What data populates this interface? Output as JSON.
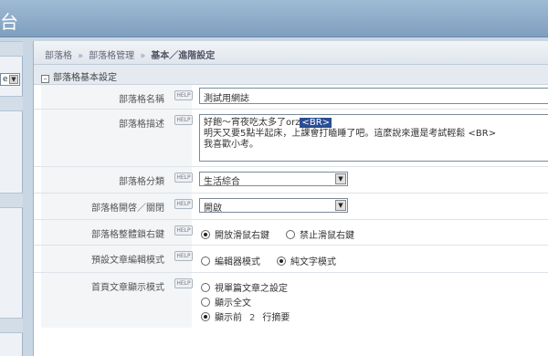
{
  "header": {
    "title": "台"
  },
  "sidebar": {
    "combo_value": "e"
  },
  "breadcrumb": {
    "items": [
      "部落格",
      "部落格管理"
    ],
    "current": "基本／進階設定"
  },
  "section": {
    "toggle": "–",
    "title": "部落格基本設定"
  },
  "help_label": "HELP",
  "rows": {
    "name": {
      "label": "部落格名稱",
      "value": "測試用網誌"
    },
    "desc": {
      "label": "部落格描述",
      "line1": "好飽～宵夜吃太多了orz",
      "line1_tag": "<BR>",
      "line2": "明天又要5點半起床，上課會打瞌睡了吧。這麼說來還是考試輕鬆 <BR>",
      "line3": "我喜歡小考。"
    },
    "category": {
      "label": "部落格分類",
      "value": "生活綜合"
    },
    "open": {
      "label": "部落格開啓／關閉",
      "value": "開啟"
    },
    "rightclick": {
      "label": "部落格整體鎖右鍵",
      "option1": "開放滑鼠右鍵",
      "option2": "禁止滑鼠右鍵",
      "selected": "開放滑鼠右鍵"
    },
    "editor": {
      "label": "預設文章編輯模式",
      "option1": "編輯器模式",
      "option2": "純文字模式",
      "selected": "純文字模式"
    },
    "display": {
      "label": "首頁文章顯示模式",
      "option1": "視單篇文章之設定",
      "option2": "顯示全文",
      "option3_prefix": "顯示前",
      "option3_num": "2",
      "option3_suffix": "行摘要",
      "selected": "顯示前"
    }
  }
}
